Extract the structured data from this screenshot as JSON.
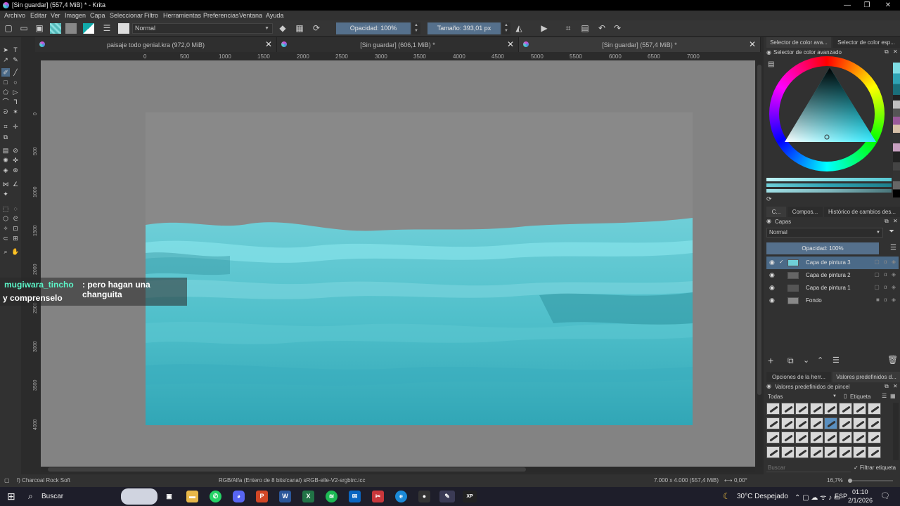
{
  "window": {
    "title": "[Sin guardar]  (557,4 MiB) * - Krita",
    "min_label": "—",
    "restore_label": "❐",
    "close_label": "✕"
  },
  "menu": [
    "Archivo",
    "Editar",
    "Ver",
    "Imagen",
    "Capa",
    "Seleccionar",
    "Filtro",
    "Herramientas",
    "Preferencias",
    "Ventana",
    "Ayuda"
  ],
  "toolbar": {
    "blend_mode": "Normal",
    "opacity": "Opacidad: 100%",
    "size": "Tamaño: 393,01 px"
  },
  "tabs": [
    {
      "label": "paisaje todo genial.kra (972,0 MiB)",
      "close": "✕"
    },
    {
      "label": "[Sin guardar]  (606,1 MiB) *",
      "close": "✕"
    },
    {
      "label": "[Sin guardar]  (557,4 MiB) *",
      "close": "✕"
    }
  ],
  "ruler_top": [
    "0",
    "500",
    "1000",
    "1500",
    "2000",
    "2500",
    "3000",
    "3500",
    "4000",
    "4500",
    "5000",
    "5500",
    "6000",
    "6500",
    "7000"
  ],
  "ruler_left": [
    "0",
    "500",
    "1000",
    "1500",
    "2000",
    "2500",
    "3000",
    "3500",
    "4000"
  ],
  "chat": {
    "user": "mugiwara_tincho",
    "message_line1": ": pero hagan una changuita",
    "message_line2": "y comprenselo"
  },
  "color_panel": {
    "tabs": [
      "Selector de color ava...",
      "Selector de color esp..."
    ],
    "title": "Selector de color avanzado"
  },
  "layers_panel": {
    "tabs": [
      "C...",
      "Compos...",
      "Histórico de cambios des..."
    ],
    "title": "Capas",
    "blend_mode": "Normal",
    "opacity": "Opacidad:  100%",
    "layers": [
      {
        "name": "Capa de pintura 3",
        "selected": true
      },
      {
        "name": "Capa de pintura 2",
        "selected": false
      },
      {
        "name": "Capa de pintura 1",
        "selected": false
      },
      {
        "name": "Fondo",
        "selected": false
      }
    ]
  },
  "presets_panel": {
    "tabs": [
      "Opciones de la herr...",
      "Valores predefinidos d..."
    ],
    "title": "Valores predefinidos de pincel",
    "filter": "Todas",
    "tag_label": "Etiqueta",
    "search_placeholder": "Buscar",
    "filter_tag_label": "✓ Filtrar etiqueta"
  },
  "status": {
    "brush": "f) Charcoal Rock Soft",
    "color_model": "RGB/Alfa (Entero de 8 bits/canal)  sRGB-elle-V2-srgbtrc.icc",
    "dimensions": "7.000 x 4.000 (557,4 MiB)",
    "rotation": "0,00°",
    "zoom": "16,7%"
  },
  "taskbar": {
    "search_label": "Buscar",
    "weather": "30°C  Despejado",
    "language": "ESP",
    "time": "01:10",
    "date": "2/1/2026"
  },
  "colors": {
    "accent": "#55708c",
    "sea_light": "#7fdde4",
    "sea_dark": "#2fa3b4"
  }
}
